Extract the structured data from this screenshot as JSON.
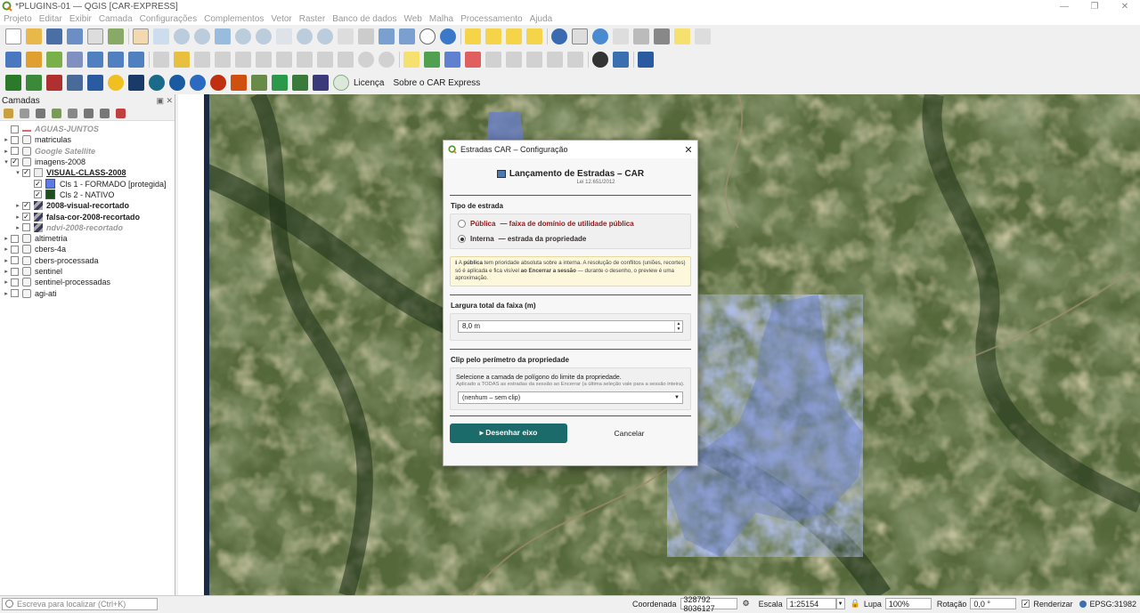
{
  "window": {
    "title": "*PLUGINS-01 — QGIS [CAR-EXPRESS]"
  },
  "menu": [
    "Projeto",
    "Editar",
    "Exibir",
    "Camada",
    "Configurações",
    "Complementos",
    "Vetor",
    "Raster",
    "Banco de dados",
    "Web",
    "Malha",
    "Processamento",
    "Ajuda"
  ],
  "plugin_toolbar": {
    "licenca": "Licença",
    "sobre": "Sobre o CAR Express"
  },
  "layers_panel": {
    "title": "Camadas",
    "layers": [
      {
        "name": "AGUAS-JUNTOS",
        "indent": 0,
        "arrow": "",
        "checked": false,
        "style": "gray",
        "icon": "line-red"
      },
      {
        "name": "matriculas",
        "indent": 0,
        "arrow": "▸",
        "checked": false,
        "style": "",
        "icon": "group"
      },
      {
        "name": "Google Satellite",
        "indent": 0,
        "arrow": "▸",
        "checked": false,
        "style": "gray",
        "icon": "group"
      },
      {
        "name": "imagens-2008",
        "indent": 0,
        "arrow": "▾",
        "checked": true,
        "style": "",
        "icon": "group"
      },
      {
        "name": "VISUAL-CLASS-2008",
        "indent": 1,
        "arrow": "▾",
        "checked": true,
        "style": "bold-underline",
        "icon": "poly"
      },
      {
        "name": "Cls 1 - FORMADO [protegida]",
        "indent": 2,
        "arrow": "",
        "checked": true,
        "style": "",
        "icon": "swatch-blue"
      },
      {
        "name": "Cls 2 - NATIVO",
        "indent": 2,
        "arrow": "",
        "checked": true,
        "style": "",
        "icon": "swatch-green"
      },
      {
        "name": "2008-visual-recortado",
        "indent": 1,
        "arrow": "▸",
        "checked": true,
        "style": "bold",
        "icon": "raster"
      },
      {
        "name": "falsa-cor-2008-recortado",
        "indent": 1,
        "arrow": "▸",
        "checked": true,
        "style": "bold",
        "icon": "raster"
      },
      {
        "name": "ndvi-2008-recortado",
        "indent": 1,
        "arrow": "▸",
        "checked": false,
        "style": "gray",
        "icon": "raster"
      },
      {
        "name": "altimetria",
        "indent": 0,
        "arrow": "▸",
        "checked": false,
        "style": "",
        "icon": "group"
      },
      {
        "name": "cbers-4a",
        "indent": 0,
        "arrow": "▸",
        "checked": false,
        "style": "",
        "icon": "group"
      },
      {
        "name": "cbers-processada",
        "indent": 0,
        "arrow": "▸",
        "checked": false,
        "style": "",
        "icon": "group"
      },
      {
        "name": "sentinel",
        "indent": 0,
        "arrow": "▸",
        "checked": false,
        "style": "",
        "icon": "group"
      },
      {
        "name": "sentinel-processadas",
        "indent": 0,
        "arrow": "▸",
        "checked": false,
        "style": "",
        "icon": "group"
      },
      {
        "name": "agi-ati",
        "indent": 0,
        "arrow": "▸",
        "checked": false,
        "style": "",
        "icon": "group"
      }
    ]
  },
  "dialog": {
    "title": "Estradas CAR – Configuração",
    "heading": "Lançamento de Estradas – CAR",
    "law": "Lei 12.651/2012",
    "tipo_title": "Tipo de estrada",
    "opt_publica_a": "Pública",
    "opt_publica_b": "— faixa de domínio de utilidade pública",
    "opt_interna_a": "Interna",
    "opt_interna_b": "— estrada da propriedade",
    "note": {
      "p1": "ℹ A ",
      "b1": "pública",
      "p2": " tem prioridade absoluta sobre a interna. A resolução de conflitos (uniões, recortes) só é aplicada e fica visível ",
      "b2": "ao Encerrar a sessão",
      "p3": " — durante o desenho, o preview é uma aproximação."
    },
    "largura_title": "Largura total da faixa (m)",
    "largura_value": "8,0 m",
    "clip_title": "Clip pelo perímetro da propriedade",
    "clip_text": "Selecione a camada de polígono do limite da propriedade.",
    "clip_sub": "Aplicado a TODAS as estradas da sessão ao Encerrar (a última seleção vale para a sessão inteira).",
    "clip_value": "(nenhum – sem clip)",
    "btn_desenhar": "▸  Desenhar eixo",
    "btn_cancelar": "Cancelar"
  },
  "statusbar": {
    "locator_placeholder": "Escreva para localizar (Ctrl+K)",
    "coord_label": "Coordenada",
    "coord_value": "328792  8036127",
    "escala_label": "Escala",
    "escala_value": "1:25154",
    "lupa_label": "Lupa",
    "lupa_value": "100%",
    "rotacao_label": "Rotação",
    "rotacao_value": "0,0 °",
    "renderizar_label": "Renderizar",
    "crs": "EPSG:31982"
  },
  "colors": {
    "accent_button": "#1b6b6b",
    "publica": "#8b1a1a",
    "class_formado": "#5b7be0",
    "class_nativo": "#1e4d1e"
  }
}
